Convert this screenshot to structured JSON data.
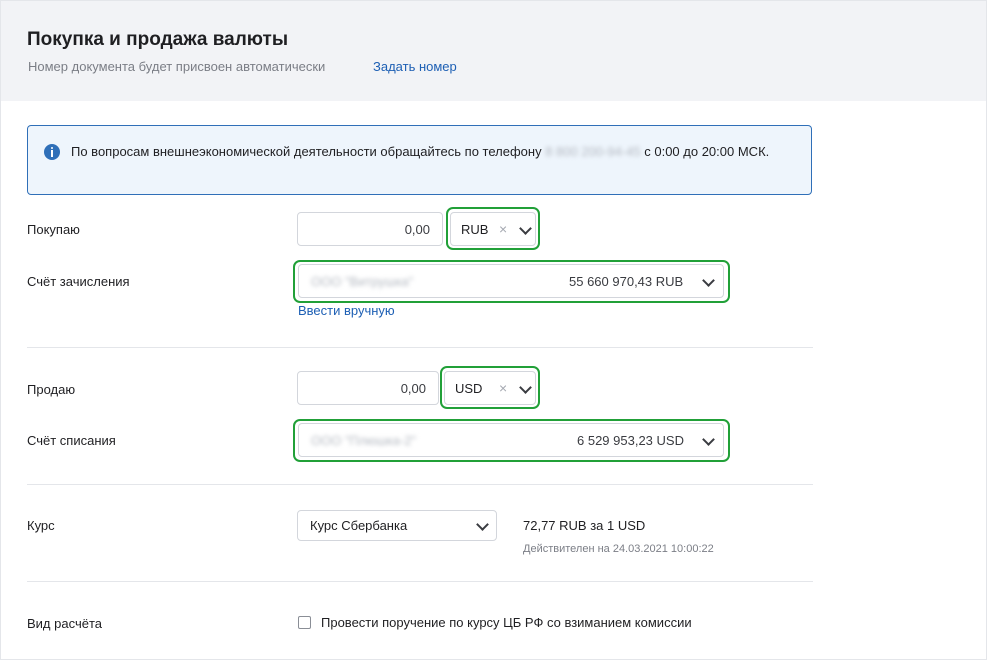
{
  "header": {
    "title": "Покупка и продажа валюты",
    "subtitle": "Номер документа будет присвоен автоматически",
    "set_number_link": "Задать номер"
  },
  "info": {
    "icon": "info-icon",
    "text_before": "По вопросам внешнеэкономической деятельности обращайтесь по телефону",
    "phone": "8 800 200-94-45",
    "text_after": "с 0:00 до 20:00 МСК."
  },
  "buy": {
    "label": "Покупаю",
    "amount": "0,00",
    "currency": "RUB",
    "clear_icon": "×"
  },
  "credit_account": {
    "label": "Счёт зачисления",
    "name": "ООО \"Витрушка\"",
    "balance": "55 660 970,43 RUB",
    "manual_link": "Ввести вручную"
  },
  "sell": {
    "label": "Продаю",
    "amount": "0,00",
    "currency": "USD",
    "clear_icon": "×"
  },
  "debit_account": {
    "label": "Счёт списания",
    "name": "ООО \"Плюшка-2\"",
    "balance": "6 529 953,23 USD"
  },
  "rate": {
    "label": "Курс",
    "selected": "Курс Сбербанка",
    "value": "72,77 RUB за 1 USD",
    "valid": "Действителен на 24.03.2021 10:00:22"
  },
  "settlement": {
    "label": "Вид расчёта",
    "checkbox_label": "Провести поручение по курсу ЦБ РФ со взиманием комиссии",
    "checked": false
  },
  "colors": {
    "accent_green": "#21a038",
    "link_blue": "#1d5fb4",
    "info_border": "#2f6fb8",
    "info_bg": "#eef5fc",
    "header_bg": "#f2f3f6"
  }
}
